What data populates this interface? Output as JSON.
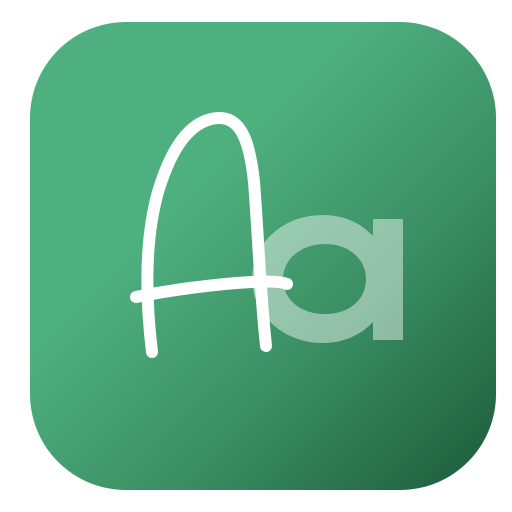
{
  "icon": {
    "glyph_name": "font-icon",
    "logo_text": "Aa",
    "colors": {
      "tile_light": "#4fb07f",
      "tile_mid": "#3a8f63",
      "tile_dark": "#1d5a3a",
      "stroke_white": "#ffffff",
      "lowercase_fill": "rgba(255,255,255,0.45)"
    }
  }
}
